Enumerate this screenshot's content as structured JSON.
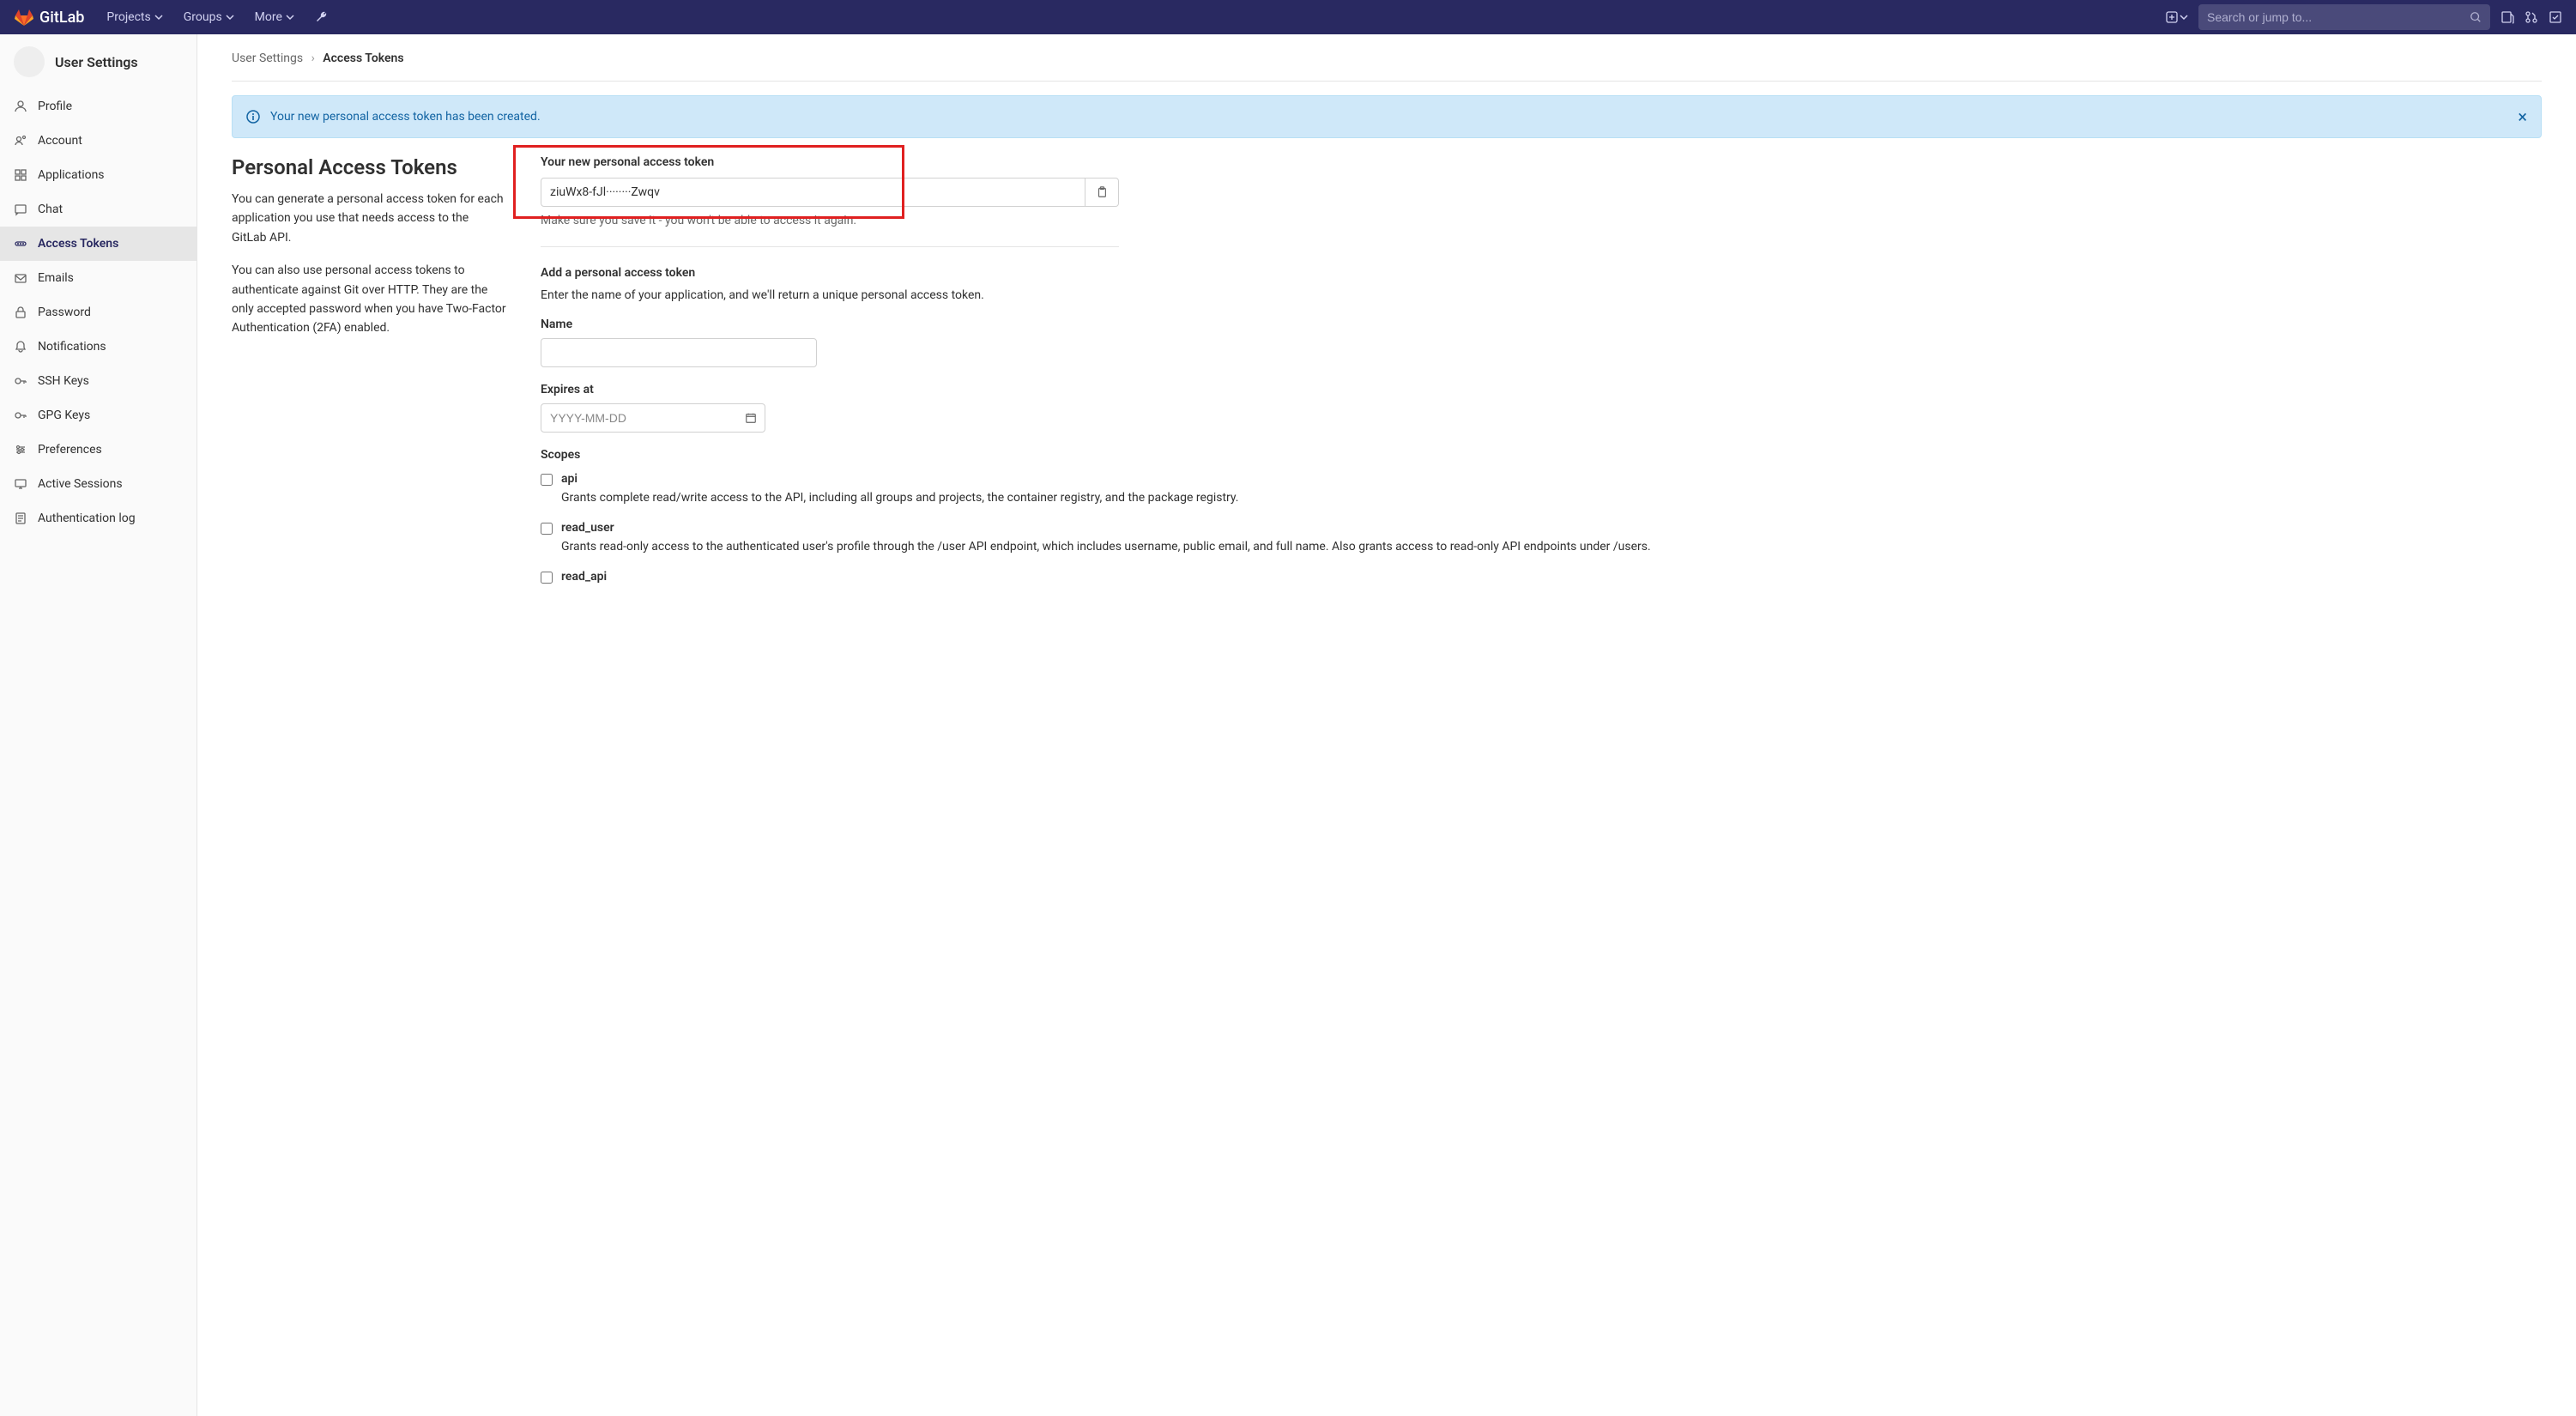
{
  "navbar": {
    "brand": "GitLab",
    "items": [
      "Projects",
      "Groups",
      "More"
    ],
    "search_placeholder": "Search or jump to..."
  },
  "sidebar": {
    "title": "User Settings",
    "items": [
      {
        "icon": "profile",
        "label": "Profile"
      },
      {
        "icon": "account",
        "label": "Account"
      },
      {
        "icon": "apps",
        "label": "Applications"
      },
      {
        "icon": "chat",
        "label": "Chat"
      },
      {
        "icon": "token",
        "label": "Access Tokens",
        "active": true
      },
      {
        "icon": "email",
        "label": "Emails"
      },
      {
        "icon": "lock",
        "label": "Password"
      },
      {
        "icon": "bell",
        "label": "Notifications"
      },
      {
        "icon": "key",
        "label": "SSH Keys"
      },
      {
        "icon": "key",
        "label": "GPG Keys"
      },
      {
        "icon": "prefs",
        "label": "Preferences"
      },
      {
        "icon": "sessions",
        "label": "Active Sessions"
      },
      {
        "icon": "log",
        "label": "Authentication log"
      }
    ]
  },
  "breadcrumb": {
    "parent": "User Settings",
    "current": "Access Tokens"
  },
  "alert": {
    "message": "Your new personal access token has been created."
  },
  "page": {
    "title": "Personal Access Tokens",
    "desc1": "You can generate a personal access token for each application you use that needs access to the GitLab API.",
    "desc2": "You can also use personal access tokens to authenticate against Git over HTTP. They are the only accepted password when you have Two-Factor Authentication (2FA) enabled."
  },
  "token": {
    "label": "Your new personal access token",
    "value": "ziuWx8-fJl········Zwqv",
    "hint": "Make sure you save it - you won't be able to access it again."
  },
  "form": {
    "heading": "Add a personal access token",
    "sub": "Enter the name of your application, and we'll return a unique personal access token.",
    "name_label": "Name",
    "expires_label": "Expires at",
    "expires_placeholder": "YYYY-MM-DD",
    "scopes_label": "Scopes",
    "scopes": [
      {
        "name": "api",
        "desc": "Grants complete read/write access to the API, including all groups and projects, the container registry, and the package registry."
      },
      {
        "name": "read_user",
        "desc": "Grants read-only access to the authenticated user's profile through the /user API endpoint, which includes username, public email, and full name. Also grants access to read-only API endpoints under /users."
      },
      {
        "name": "read_api",
        "desc": ""
      }
    ]
  }
}
